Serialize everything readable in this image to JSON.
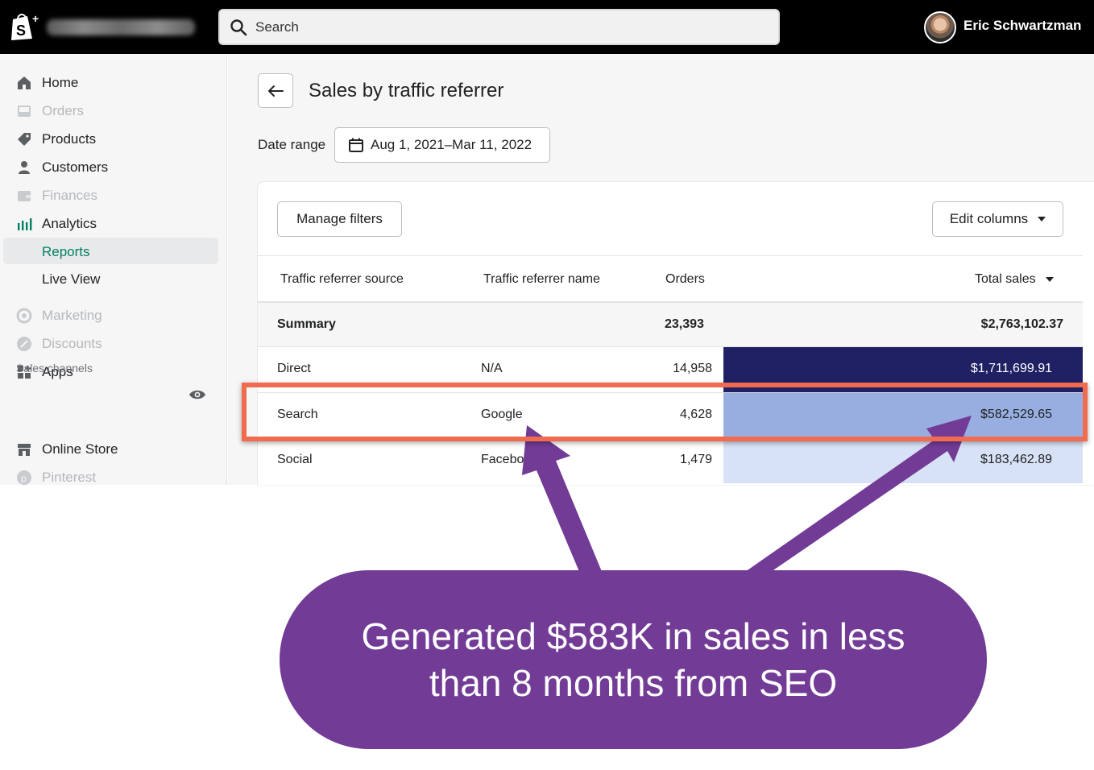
{
  "topbar": {
    "search_placeholder": "Search",
    "user_name": "Eric Schwartzman"
  },
  "sidebar": {
    "items": [
      {
        "label": "Home",
        "icon": "home-icon",
        "enabled": true
      },
      {
        "label": "Orders",
        "icon": "inbox-icon",
        "enabled": false
      },
      {
        "label": "Products",
        "icon": "tag-icon",
        "enabled": true
      },
      {
        "label": "Customers",
        "icon": "person-icon",
        "enabled": true
      },
      {
        "label": "Finances",
        "icon": "wallet-icon",
        "enabled": false
      },
      {
        "label": "Analytics",
        "icon": "bar-chart-icon",
        "enabled": true
      }
    ],
    "analytics_sub": [
      {
        "label": "Reports",
        "selected": true
      },
      {
        "label": "Live View",
        "selected": false
      }
    ],
    "items2": [
      {
        "label": "Marketing",
        "icon": "target-icon",
        "enabled": false
      },
      {
        "label": "Discounts",
        "icon": "discount-icon",
        "enabled": false
      },
      {
        "label": "Apps",
        "icon": "apps-grid-icon",
        "enabled": true
      }
    ],
    "sales_channels_label": "Sales channels",
    "channels": [
      {
        "label": "Online Store",
        "icon": "store-icon",
        "enabled": true
      },
      {
        "label": "Pinterest",
        "icon": "pinterest-icon",
        "enabled": false
      }
    ]
  },
  "page": {
    "title": "Sales by traffic referrer",
    "date_range_label": "Date range",
    "date_range_value": "Aug 1, 2021–Mar 11, 2022"
  },
  "table": {
    "manage_filters_label": "Manage filters",
    "edit_columns_label": "Edit columns",
    "headers": [
      "Traffic referrer source",
      "Traffic referrer name",
      "Orders",
      "Total sales"
    ],
    "summary": {
      "label": "Summary",
      "orders": "23,393",
      "total_sales": "$2,763,102.37"
    },
    "rows": [
      {
        "source": "Direct",
        "name": "N/A",
        "orders": "14,958",
        "total_sales": "$1,711,699.91",
        "bar_color": "#202165",
        "text_color": "#ffffff"
      },
      {
        "source": "Search",
        "name": "Google",
        "orders": "4,628",
        "total_sales": "$582,529.65",
        "bar_color": "#98aee1",
        "text_color": "#202223"
      },
      {
        "source": "Social",
        "name": "Facebo",
        "orders": "1,479",
        "total_sales": "$183,462.89",
        "bar_color": "#d8e2f6",
        "text_color": "#202223"
      }
    ]
  },
  "annotation": {
    "callout_line1": "Generated $583K in sales in less",
    "callout_line2": "than 8 months from SEO",
    "highlight_color": "#f06b4f",
    "callout_color": "#723b96"
  }
}
